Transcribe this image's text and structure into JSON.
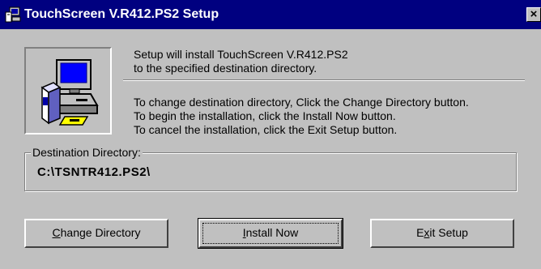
{
  "window": {
    "title": "TouchScreen V.R412.PS2 Setup",
    "close_glyph": "×"
  },
  "icon": {
    "name": "computer-setup-icon"
  },
  "message": {
    "intro_line1": "Setup will install TouchScreen V.R412.PS2",
    "intro_line2": "to the specified destination directory.",
    "instr_line1": "To change destination directory, Click the Change Directory button.",
    "instr_line2": "To begin the installation, click the Install Now button.",
    "instr_line3": "To cancel the installation, click the Exit Setup button."
  },
  "destination": {
    "label": "Destination Directory:",
    "path": "C:\\TSNTR412.PS2\\"
  },
  "buttons": {
    "change_dir": {
      "pre": "",
      "accel": "C",
      "post": "hange Directory"
    },
    "install_now": {
      "pre": "",
      "accel": "I",
      "post": "nstall Now"
    },
    "exit_setup": {
      "pre": "E",
      "accel": "x",
      "post": "it Setup"
    }
  }
}
